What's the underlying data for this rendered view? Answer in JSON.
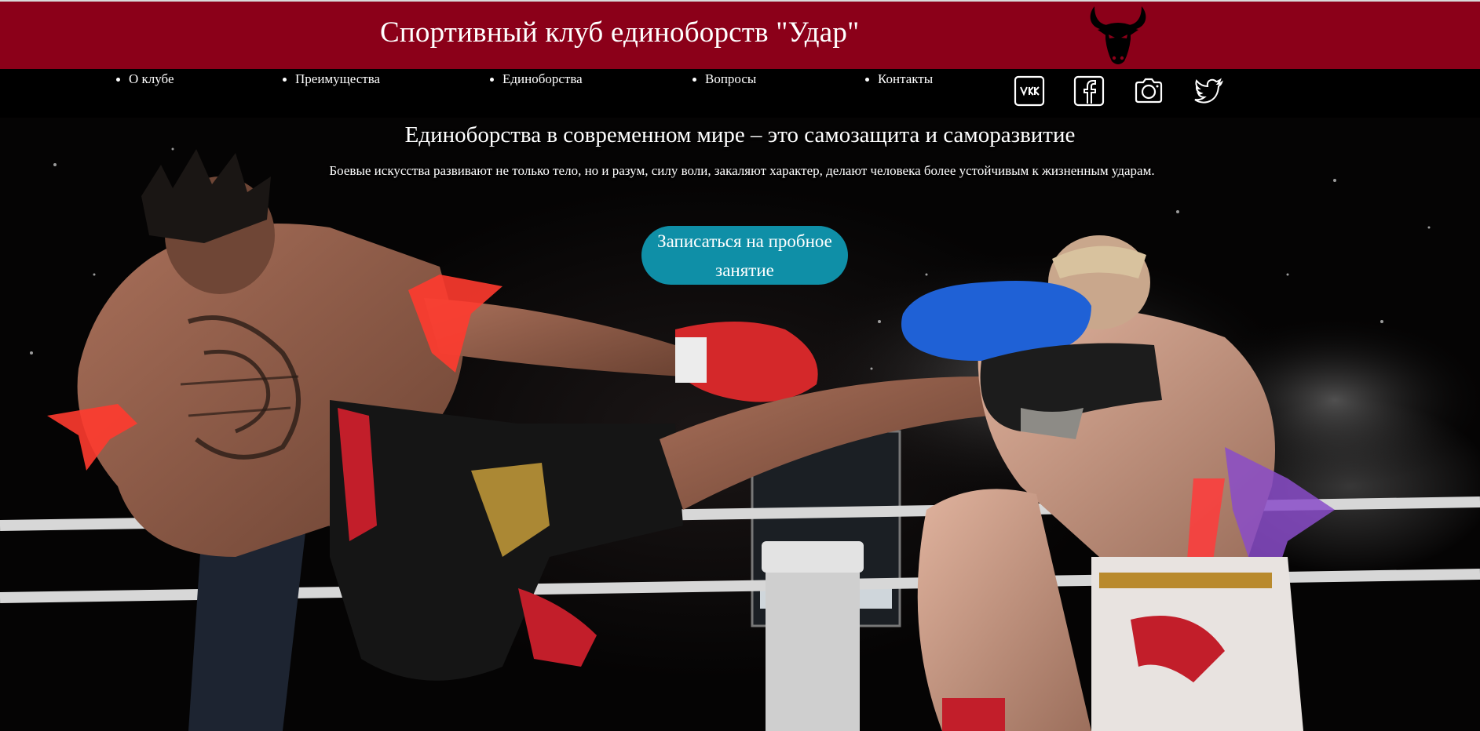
{
  "header": {
    "title": "Спортивный клуб единоборств \"Удар\"",
    "logo_icon": "bull-head-icon",
    "background": "#8b0019"
  },
  "nav": {
    "items": [
      {
        "label": "О клубе"
      },
      {
        "label": "Преимущества"
      },
      {
        "label": "Единоборства"
      },
      {
        "label": "Вопросы"
      },
      {
        "label": "Контакты"
      }
    ],
    "social": [
      {
        "icon": "vk-icon"
      },
      {
        "icon": "facebook-icon"
      },
      {
        "icon": "instagram-camera-icon"
      },
      {
        "icon": "twitter-bird-icon"
      }
    ]
  },
  "hero": {
    "title": "Единоборства в современном мире – это самозащита и саморазвитие",
    "text": "Боевые искусства развивают не только тело, но и разум, силу воли, закаляют характер, делают человека более устойчивым к жизненным ударам.",
    "cta_label": "Записаться на пробное занятие",
    "cta_color": "#0f8fa7",
    "background_image": "kickboxing-fight-photo"
  }
}
